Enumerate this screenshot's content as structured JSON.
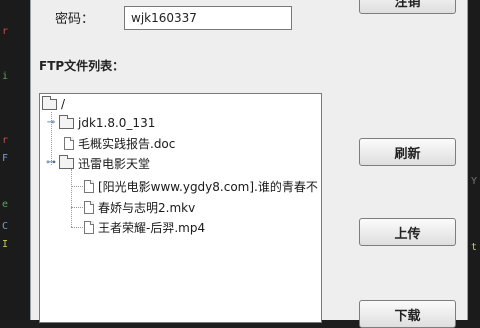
{
  "code_behind": {
    "left_glyphs": [
      "r",
      "i",
      "r",
      "F",
      "e",
      "C",
      "I"
    ],
    "right_glyphs": [
      "Y",
      "t"
    ]
  },
  "dialog": {
    "password_label": "密码：",
    "password_value": "wjk160337",
    "ftp_list_label": "FTP文件列表：",
    "tree": {
      "root": "/",
      "items": [
        {
          "label": "jdk1.8.0_131",
          "type": "folder",
          "expanded": false
        },
        {
          "label": "毛概实践报告.doc",
          "type": "file"
        },
        {
          "label": "迅雷电影天堂",
          "type": "folder",
          "expanded": true
        },
        {
          "label": "[阳光电影www.ygdy8.com].谁的青春不",
          "type": "file"
        },
        {
          "label": "春娇与志明2.mkv",
          "type": "file"
        },
        {
          "label": "王者荣耀-后羿.mp4",
          "type": "file"
        }
      ]
    },
    "buttons": {
      "top": "注销",
      "refresh": "刷新",
      "upload": "上传",
      "download": "下载"
    }
  }
}
